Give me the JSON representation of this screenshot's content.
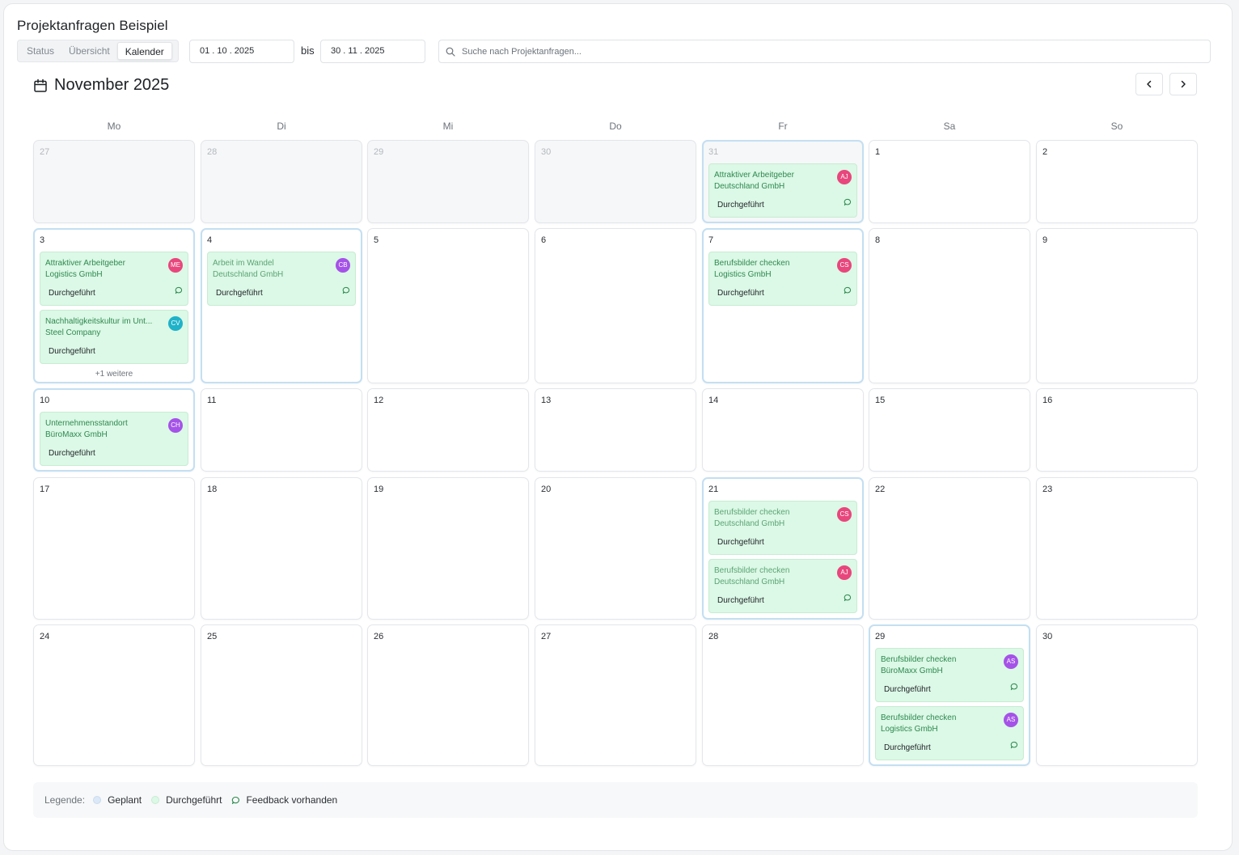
{
  "page_title": "Projektanfragen Beispiel",
  "view_tabs": [
    {
      "label": "Status",
      "active": false
    },
    {
      "label": "Übersicht",
      "active": false
    },
    {
      "label": "Kalender",
      "active": true
    }
  ],
  "date_range": {
    "from": "01 . 10 . 2025",
    "separator": "bis",
    "to": "30 . 11 . 2025"
  },
  "search": {
    "placeholder": "Suche nach Projektanfragen..."
  },
  "calendar": {
    "month_label": "November 2025",
    "weekdays": [
      "Mo",
      "Di",
      "Mi",
      "Do",
      "Fr",
      "Sa",
      "So"
    ],
    "weeks": [
      [
        {
          "day": "27",
          "outside": true,
          "events": []
        },
        {
          "day": "28",
          "outside": true,
          "events": []
        },
        {
          "day": "29",
          "outside": true,
          "events": []
        },
        {
          "day": "30",
          "outside": true,
          "events": []
        },
        {
          "day": "31",
          "outside": true,
          "events": [
            {
              "title": "Attraktiver Arbeitgeber",
              "company": "Deutschland GmbH",
              "status": "Durchgeführt",
              "initials": "AJ",
              "avatar_color": "#e8467c",
              "feedback": true,
              "muted": false
            }
          ]
        },
        {
          "day": "1",
          "outside": false,
          "events": []
        },
        {
          "day": "2",
          "outside": false,
          "events": []
        }
      ],
      [
        {
          "day": "3",
          "outside": false,
          "events": [
            {
              "title": "Attraktiver Arbeitgeber",
              "company": "Logistics GmbH",
              "status": "Durchgeführt",
              "initials": "ME",
              "avatar_color": "#e8467c",
              "feedback": true,
              "muted": false
            },
            {
              "title": "Nachhaltigkeitskultur im Unt...",
              "company": "Steel Company",
              "status": "Durchgeführt",
              "initials": "CV",
              "avatar_color": "#1fb2c9",
              "feedback": false,
              "muted": false
            }
          ],
          "more": "+1 weitere"
        },
        {
          "day": "4",
          "outside": false,
          "events": [
            {
              "title": "Arbeit im Wandel",
              "company": "Deutschland GmbH",
              "status": "Durchgeführt",
              "initials": "CB",
              "avatar_color": "#a552e8",
              "feedback": true,
              "muted": true
            }
          ]
        },
        {
          "day": "5",
          "outside": false,
          "events": []
        },
        {
          "day": "6",
          "outside": false,
          "events": []
        },
        {
          "day": "7",
          "outside": false,
          "events": [
            {
              "title": "Berufsbilder checken",
              "company": "Logistics GmbH",
              "status": "Durchgeführt",
              "initials": "CS",
              "avatar_color": "#e8467c",
              "feedback": true,
              "muted": false
            }
          ]
        },
        {
          "day": "8",
          "outside": false,
          "events": []
        },
        {
          "day": "9",
          "outside": false,
          "events": []
        }
      ],
      [
        {
          "day": "10",
          "outside": false,
          "events": [
            {
              "title": "Unternehmensstandort",
              "company": "BüroMaxx GmbH",
              "status": "Durchgeführt",
              "initials": "CH",
              "avatar_color": "#a552e8",
              "feedback": false,
              "muted": false
            }
          ]
        },
        {
          "day": "11",
          "outside": false,
          "events": []
        },
        {
          "day": "12",
          "outside": false,
          "events": []
        },
        {
          "day": "13",
          "outside": false,
          "events": []
        },
        {
          "day": "14",
          "outside": false,
          "events": []
        },
        {
          "day": "15",
          "outside": false,
          "events": []
        },
        {
          "day": "16",
          "outside": false,
          "events": []
        }
      ],
      [
        {
          "day": "17",
          "outside": false,
          "events": []
        },
        {
          "day": "18",
          "outside": false,
          "events": []
        },
        {
          "day": "19",
          "outside": false,
          "events": []
        },
        {
          "day": "20",
          "outside": false,
          "events": []
        },
        {
          "day": "21",
          "outside": false,
          "events": [
            {
              "title": "Berufsbilder checken",
              "company": "Deutschland GmbH",
              "status": "Durchgeführt",
              "initials": "CS",
              "avatar_color": "#e8467c",
              "feedback": false,
              "muted": true
            },
            {
              "title": "Berufsbilder checken",
              "company": "Deutschland GmbH",
              "status": "Durchgeführt",
              "initials": "AJ",
              "avatar_color": "#e8467c",
              "feedback": true,
              "muted": true
            }
          ]
        },
        {
          "day": "22",
          "outside": false,
          "events": []
        },
        {
          "day": "23",
          "outside": false,
          "events": []
        }
      ],
      [
        {
          "day": "24",
          "outside": false,
          "events": []
        },
        {
          "day": "25",
          "outside": false,
          "events": []
        },
        {
          "day": "26",
          "outside": false,
          "events": []
        },
        {
          "day": "27",
          "outside": false,
          "events": []
        },
        {
          "day": "28",
          "outside": false,
          "events": []
        },
        {
          "day": "29",
          "outside": false,
          "events": [
            {
              "title": "Berufsbilder checken",
              "company": "BüroMaxx GmbH",
              "status": "Durchgeführt",
              "initials": "AS",
              "avatar_color": "#a552e8",
              "feedback": true,
              "muted": false
            },
            {
              "title": "Berufsbilder checken",
              "company": "Logistics GmbH",
              "status": "Durchgeführt",
              "initials": "AS",
              "avatar_color": "#a552e8",
              "feedback": true,
              "muted": false
            }
          ]
        },
        {
          "day": "30",
          "outside": false,
          "events": []
        }
      ]
    ]
  },
  "legend": {
    "label": "Legende:",
    "items": [
      {
        "label": "Geplant",
        "color": "#dbe8f7",
        "icon": "dot"
      },
      {
        "label": "Durchgeführt",
        "color": "#dcf8e6",
        "icon": "dot"
      },
      {
        "label": "Feedback vorhanden",
        "color": "#2d8a4f",
        "icon": "feedback-bubble-icon"
      }
    ]
  }
}
